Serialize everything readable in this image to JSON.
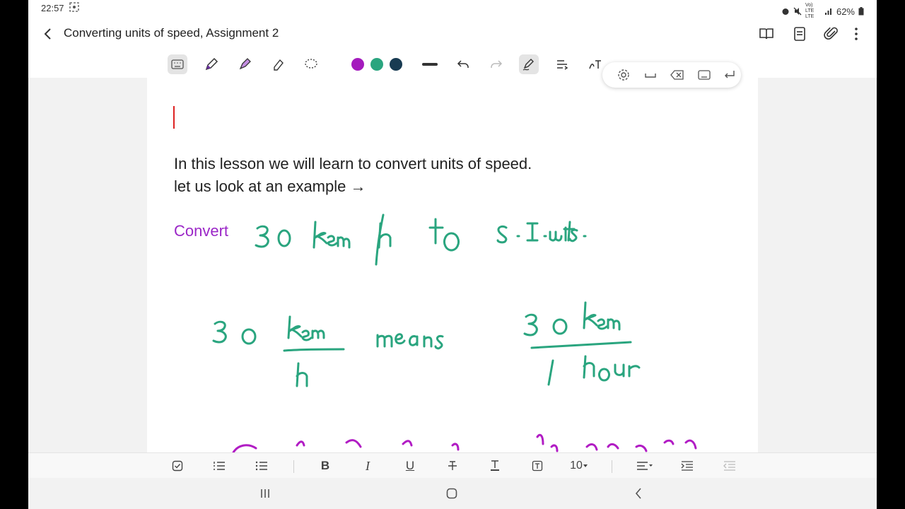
{
  "status": {
    "time": "22:57",
    "network": "Vo) LTE LTE",
    "battery": "62%"
  },
  "header": {
    "title": "Converting units of speed, Assignment 2"
  },
  "note": {
    "line1": "In this lesson we will learn to convert units of speed.",
    "line2": "let us look at an example →",
    "convert_label": "Convert"
  },
  "format_bar": {
    "bold": "B",
    "italic": "I",
    "underline": "U",
    "font_size": "10"
  },
  "colors": {
    "purple": "#a41bbd",
    "green": "#2aa57f",
    "navy": "#183b52",
    "convert_text": "#9b27c7"
  },
  "icons": [
    "back-icon",
    "book-icon",
    "page-icon",
    "paperclip-icon",
    "more-icon",
    "keyboard-icon",
    "pen-icon",
    "highlighter-icon",
    "eraser-icon",
    "lasso-icon",
    "undo-icon",
    "redo-icon",
    "handwriting-icon",
    "text-align-icon",
    "settings-icon",
    "space-icon",
    "backspace-icon",
    "enter-icon",
    "checkbox-icon",
    "numbered-list-icon",
    "bullet-list-icon",
    "strikethrough-icon",
    "text-color-icon",
    "text-box-icon",
    "align-icon",
    "indent-icon",
    "outdent-icon",
    "recents-icon",
    "home-icon",
    "nav-back-icon"
  ]
}
